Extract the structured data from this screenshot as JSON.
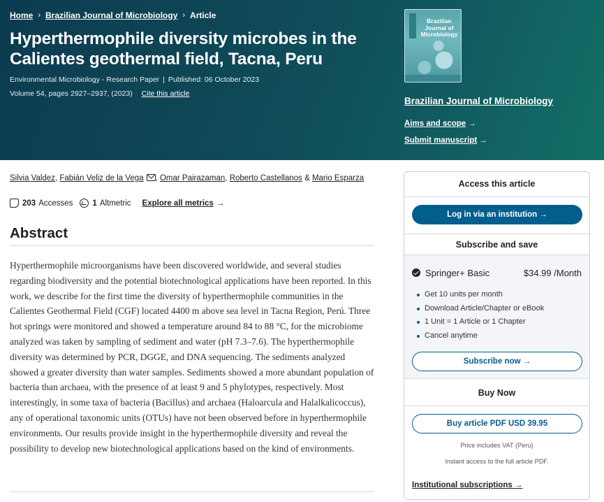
{
  "breadcrumb": {
    "home": "Home",
    "journal": "Brazilian Journal of Microbiology",
    "current": "Article",
    "separator": "›"
  },
  "article": {
    "title": "Hyperthermophile diversity microbes in the Calientes geothermal field, Tacna, Peru",
    "type": "Environmental Microbiology - Research Paper",
    "published": "Published: 06 October 2023",
    "volume": "Volume 54, pages 2927–2937, (2023)",
    "cite_label": "Cite this article"
  },
  "journal": {
    "cover_title": "Brazilian Journal of Microbiology",
    "name": "Brazilian Journal of Microbiology",
    "aims_label": "Aims and scope",
    "submit_label": "Submit manuscript",
    "arrow": "→"
  },
  "authors": {
    "list": [
      "Silvia Valdez",
      "Fabián Veliz de la Vega",
      "Omar Pairazaman",
      "Roberto Castellanos",
      "Mario Esparza"
    ],
    "comma": ", ",
    "and": " & "
  },
  "metrics": {
    "accesses_count": "203",
    "accesses_label": "Accesses",
    "altmetric_count": "1",
    "altmetric_label": "Altmetric",
    "explore_label": "Explore all metrics",
    "arrow": "→"
  },
  "abstract": {
    "heading": "Abstract",
    "text": "Hyperthermophile microorganisms have been discovered worldwide, and several studies regarding biodiversity and the potential biotechnological applications have been reported. In this work, we describe for the first time the diversity of hyperthermophile communities in the Calientes Geothermal Field (CGF) located 4400 m above sea level in Tacna Region, Perú. Three hot springs were monitored and showed a temperature around 84 to 88 °C, for the microbiome analyzed was taken by sampling of sediment and water (pH 7.3–7.6). The hyperthermophile diversity was determined by PCR, DGGE, and DNA sequencing. The sediments analyzed showed a greater diversity than water samples. Sediments showed a more abundant population of bacteria than archaea, with the presence of at least 9 and 5 phylotypes, respectively. Most interestingly, in some taxa of bacteria (Bacillus) and archaea (Haloarcula and Halalkalicoccus), any of operational taxonomic units (OTUs) have not been observed before in hyperthermophile environments. Our results provide insight in the hyperthermophile diversity and reveal the possibility to develop new biotechnological applications based on the kind of environments."
  },
  "sidebar": {
    "access_heading": "Access this article",
    "login_label": "Log in via an institution",
    "subscribe_heading": "Subscribe and save",
    "plan_name": "Springer+ Basic",
    "plan_price": "$34.99 /Month",
    "features": [
      "Get 10 units per month",
      "Download Article/Chapter or eBook",
      "1 Unit = 1 Article or 1 Chapter",
      "Cancel anytime"
    ],
    "subscribe_label": "Subscribe now",
    "buy_heading": "Buy Now",
    "buy_label": "Buy article PDF USD 39.95",
    "vat_note": "Price includes VAT (Peru)",
    "instant_note": "Instant access to the full article PDF.",
    "institutional_label": "Institutional subscriptions",
    "arrow": "→"
  },
  "colors": {
    "header_bg": "#0f4a58",
    "brand_blue": "#025e8d",
    "plan_bg": "#f3f5f8"
  }
}
